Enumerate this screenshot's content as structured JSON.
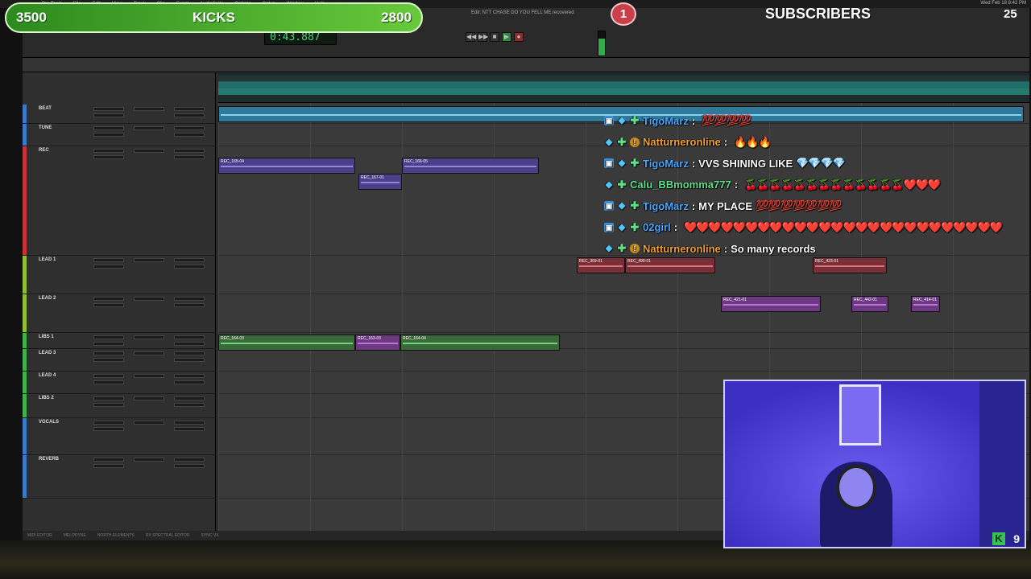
{
  "menubar": {
    "items": [
      "Pro Tools",
      "File",
      "Edit",
      "View",
      "Track",
      "Clip",
      "Event",
      "AudioSuite",
      "Options",
      "Setup",
      "Window",
      "Help"
    ],
    "clock": "Wed Feb 18  8:42 PM",
    "document_title": "Edit: NTT CHASE DO YOU FELL ME.recovered"
  },
  "transport": {
    "counter": "0:43.887",
    "buttons": [
      "◀◀",
      "▶▶",
      "■",
      "▶",
      "●"
    ]
  },
  "overlay": {
    "kicks_left": "3500",
    "kicks_label": "KICKS",
    "kicks_right": "2800",
    "goal_badge": "1",
    "subscribers_label": "SUBSCRIBERS",
    "subscribers_count": "25"
  },
  "tracks": [
    {
      "name": "BEAT",
      "color": "#3b78c9"
    },
    {
      "name": "TUNE",
      "color": "#3b78c9"
    },
    {
      "name": "REC",
      "color": "#c9313b"
    },
    {
      "name": "LEAD 1",
      "color": "#8fbf2f"
    },
    {
      "name": "LEAD 2",
      "color": "#8fbf2f"
    },
    {
      "name": "LIBS 1",
      "color": "#3fb24a"
    },
    {
      "name": "LEAD 3",
      "color": "#3fb24a"
    },
    {
      "name": "LEAD 4",
      "color": "#3fb24a"
    },
    {
      "name": "LIBS 2",
      "color": "#3fb24a"
    },
    {
      "name": "VOCALS",
      "color": "#3b78c9"
    },
    {
      "name": "REVERB",
      "color": "#3b78c9"
    }
  ],
  "clips": [
    {
      "name": "REC_165-04",
      "lane": 2,
      "style": "purple"
    },
    {
      "name": "REC_167-01",
      "lane": 2,
      "style": "purple"
    },
    {
      "name": "REC_166-05",
      "lane": 2,
      "style": "purple"
    },
    {
      "name": "REC_369-01",
      "lane": 3,
      "style": "red"
    },
    {
      "name": "REC_490-01",
      "lane": 3,
      "style": "red"
    },
    {
      "name": "REC_423-01",
      "lane": 3,
      "style": "red"
    },
    {
      "name": "REC_421-01",
      "lane": 4,
      "style": "magenta"
    },
    {
      "name": "REC_442-01",
      "lane": 4,
      "style": "magenta"
    },
    {
      "name": "REC_414-01",
      "lane": 4,
      "style": "magenta"
    },
    {
      "name": "REC_164-03",
      "lane": 5,
      "style": "green"
    },
    {
      "name": "REC_163-03",
      "lane": 5,
      "style": "magenta"
    },
    {
      "name": "REC_164-04",
      "lane": 5,
      "style": "green"
    }
  ],
  "chat": [
    {
      "user": "TigoMarz",
      "user_color": "#4aa8ff",
      "sep": ":",
      "text": "",
      "emotes": "💯💯💯💯",
      "badges": [
        "blue",
        "gem",
        "green"
      ]
    },
    {
      "user": "Natturneronline",
      "user_color": "#f0a030",
      "sep": ":",
      "text": "",
      "emotes": "🔥🔥🔥",
      "badges": [
        "gem",
        "green",
        "gold"
      ]
    },
    {
      "user": "TigoMarz",
      "user_color": "#4aa8ff",
      "sep": ":",
      "text": "VVS SHINING LIKE",
      "emotes": "💎💎💎💎",
      "badges": [
        "blue",
        "gem",
        "green"
      ]
    },
    {
      "user": "Calu_BBmomma777",
      "user_color": "#5fe08a",
      "sep": ":",
      "text": "",
      "emotes": "🍒🍒🍒🍒🍒🍒🍒🍒🍒🍒🍒🍒🍒❤️❤️❤️",
      "badges": [
        "gem",
        "green"
      ]
    },
    {
      "user": "TigoMarz",
      "user_color": "#4aa8ff",
      "sep": ":",
      "text": "MY PLACE",
      "emotes": "💯💯💯💯💯💯💯",
      "badges": [
        "blue",
        "gem",
        "green"
      ]
    },
    {
      "user": "02girl",
      "user_color": "#4aa8ff",
      "sep": ":",
      "text": "",
      "emotes": "❤️❤️❤️❤️❤️❤️❤️❤️❤️❤️❤️❤️❤️❤️❤️❤️❤️❤️❤️❤️❤️❤️❤️❤️❤️❤️",
      "badges": [
        "blue",
        "gem",
        "green"
      ]
    },
    {
      "user": "Natturneronline",
      "user_color": "#f0a030",
      "sep": ":",
      "text": "So many records",
      "emotes": "",
      "badges": [
        "gem",
        "green",
        "gold"
      ]
    }
  ],
  "bottom_tabs": [
    "MIDI EDITOR",
    "MELODYNE",
    "NORTH ELEMENTS",
    "RX SPECTRAL EDITOR",
    "SYNC VX"
  ],
  "webcam": {
    "logo": "K",
    "viewer_count": "9"
  },
  "icons": [
    "play-icon",
    "stop-icon",
    "record-icon",
    "rewind-icon",
    "fast-forward-icon",
    "twitch-badge-icon",
    "gem-icon",
    "plus-icon",
    "gold-coin-icon"
  ]
}
